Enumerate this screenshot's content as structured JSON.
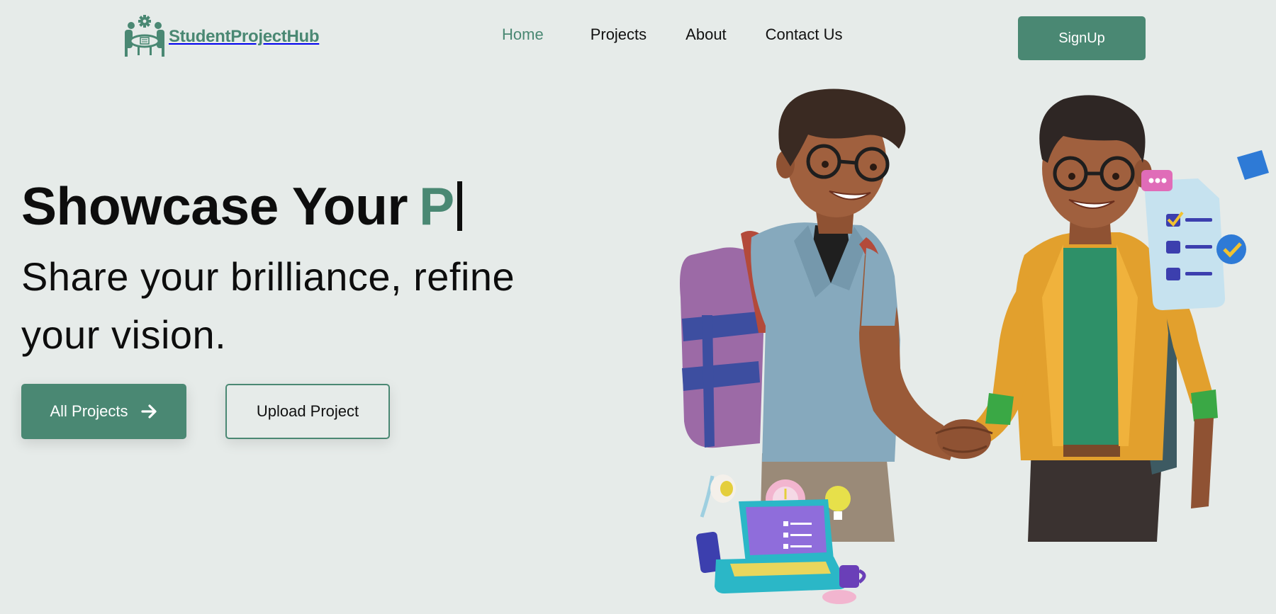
{
  "brand": {
    "name": "StudentProjectHub",
    "color": "#4a8873",
    "logo_icon": "team-meeting-gear-icon"
  },
  "nav": {
    "items": [
      {
        "label": "Home",
        "active": true
      },
      {
        "label": "Projects",
        "active": false
      },
      {
        "label": "About",
        "active": false
      },
      {
        "label": "Contact Us",
        "active": false
      }
    ],
    "signup_label": "SignUp"
  },
  "hero": {
    "headline_static": "Showcase Your",
    "headline_typed": "P",
    "subtitle": "Share your brilliance, refine your vision.",
    "primary_button": {
      "label": "All Projects",
      "icon": "arrow-right-icon"
    },
    "secondary_button": {
      "label": "Upload Project"
    },
    "illustration": "two-students-handshake-illustration"
  },
  "colors": {
    "background": "#e6ebe9",
    "accent": "#4a8873",
    "text": "#0d0d0d"
  }
}
